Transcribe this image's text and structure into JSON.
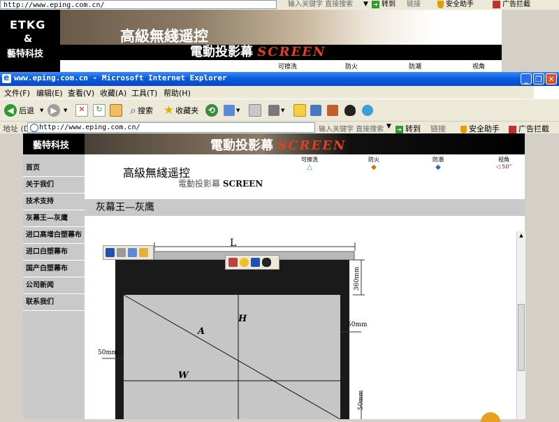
{
  "background_window": {
    "address_url": "http://www.eping.com.cn/",
    "search_placeholder": "输入关键字 直接搜索",
    "go_label": "转到",
    "links_label": "链接",
    "safety_label": "安全助手",
    "adblock_label": "广告拦截",
    "logo_line1": "ETKG",
    "logo_line2": "&",
    "logo_line3": "藝特科技",
    "banner_title": "高級無綫遥控",
    "banner_subtitle": "電動投影幕",
    "banner_word": "SCREEN",
    "features": [
      "可擦洗",
      "防火",
      "防潮",
      "视角"
    ]
  },
  "window": {
    "title": "www.eping.com.cn - Microsoft Internet Explorer",
    "title_colors": {
      "start": "#3c8cf5",
      "end": "#0848c8",
      "close": "#d8502c"
    }
  },
  "menu": [
    "文件(F)",
    "编辑(E)",
    "查看(V)",
    "收藏(A)",
    "工具(T)",
    "帮助(H)"
  ],
  "toolbar": {
    "back_label": "后退",
    "search_label": "搜索",
    "favorites_label": "收藏夹"
  },
  "address_bar": {
    "label": "地址 (D)",
    "url": "http://www.eping.com.cn/",
    "search_placeholder": "输入关键字 直接搜索",
    "go_label": "转到",
    "links_label": "链接",
    "safety_label": "安全助手",
    "adblock_label": "广告拦截"
  },
  "page": {
    "logo_text": "藝特科技",
    "banner_subtitle": "電動投影幕",
    "banner_word": "SCREEN",
    "header_title": "高級無綫遥控",
    "header_subtitle": "電動投影幕",
    "header_word": "SCREEN",
    "features": [
      {
        "label": "可擦洗",
        "icon": "△"
      },
      {
        "label": "防火",
        "icon": "◆"
      },
      {
        "label": "防潮",
        "icon": "◆"
      },
      {
        "label": "视角",
        "icon": "◁ 50°"
      }
    ],
    "nav": [
      "首页",
      "关于我们",
      "技术支持",
      "灰幕王—灰鹰",
      "进口高增白塑幕布",
      "进口白塑幕布",
      "国产白塑幕布",
      "公司新闻",
      "联系我们"
    ],
    "section_title": "灰幕王—灰鹰",
    "diagram_labels": {
      "L": "L",
      "H": "H",
      "A": "A",
      "W": "W",
      "dim_top": "360mm",
      "dim_right": "50mm",
      "dim_left": "50mm",
      "dim_bottom": "50mm"
    }
  }
}
